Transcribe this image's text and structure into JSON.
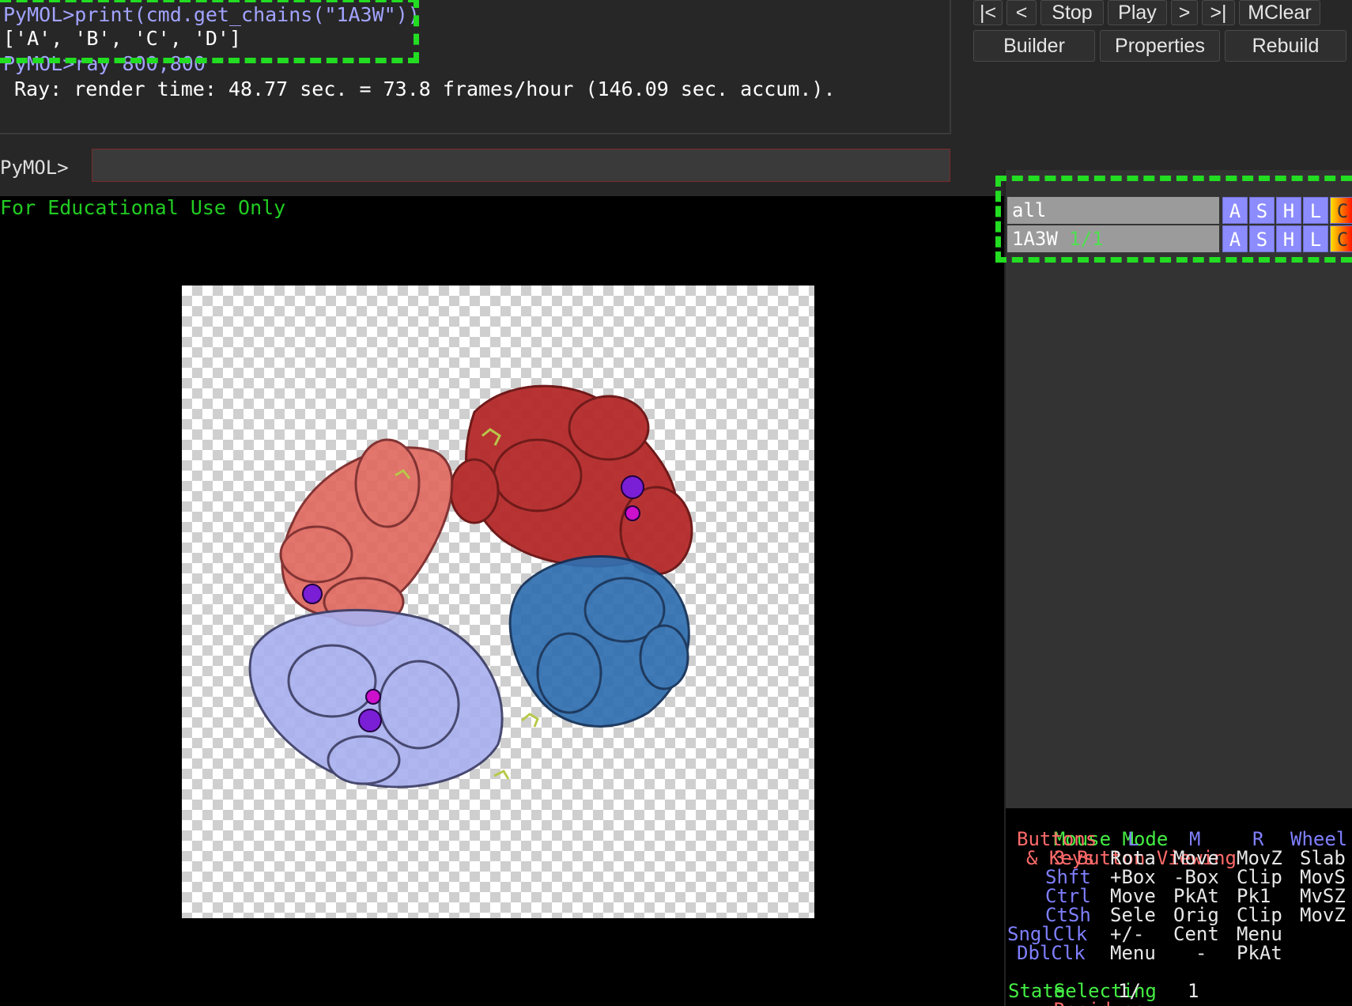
{
  "console": {
    "lines": [
      "PyMOL>print(cmd.get_chains(\"1A3W\"))",
      "['A', 'B', 'C', 'D']",
      "PyMOL>ray 800,800",
      "Ray: render time: 48.77 sec. = 73.8 frames/hour (146.09 sec. accum.)."
    ]
  },
  "command": {
    "prompt": "PyMOL>",
    "value": ""
  },
  "buttons": {
    "first": "|<",
    "prev": "<",
    "stop": "Stop",
    "play": "Play",
    "next": ">",
    "last": ">|",
    "mclear": "MClear",
    "builder": "Builder",
    "properties": "Properties",
    "rebuild": "Rebuild"
  },
  "viewer": {
    "watermark": "For Educational Use Only"
  },
  "objects": [
    {
      "name": "all",
      "state": "",
      "buttons": [
        "A",
        "S",
        "H",
        "L",
        "C"
      ]
    },
    {
      "name": "1A3W",
      "state": "1/1",
      "buttons": [
        "A",
        "S",
        "H",
        "L",
        "C"
      ]
    }
  ],
  "mousehelp": {
    "mode_label": "Mouse Mode",
    "mode_value": "3-Button Viewing",
    "buttons_label": "Buttons",
    "col_l": "L",
    "col_m": "M",
    "col_r": "R",
    "col_wheel": "Wheel",
    "keys_label": "& Keys",
    "rows": [
      {
        "key": "",
        "l": "Rota",
        "m": "Move",
        "r": "MovZ",
        "w": "Slab"
      },
      {
        "key": "Shft",
        "l": "+Box",
        "m": "-Box",
        "r": "Clip",
        "w": "MovS"
      },
      {
        "key": "Ctrl",
        "l": "Move",
        "m": "PkAt",
        "r": "Pk1",
        "w": "MvSZ"
      },
      {
        "key": "CtSh",
        "l": "Sele",
        "m": "Orig",
        "r": "Clip",
        "w": "MovZ"
      },
      {
        "key": "SnglClk",
        "l": "+/-",
        "m": "Cent",
        "r": "Menu",
        "w": ""
      },
      {
        "key": "DblClk",
        "l": "Menu",
        "m": "-",
        "r": "PkAt",
        "w": ""
      }
    ],
    "selecting_label": "Selecting",
    "selecting_value": "Residues",
    "state_label": "State",
    "state_value": "1/",
    "state_count": "1"
  },
  "colors": {
    "accent_green": "#22dd22",
    "prompt_blue": "#a2a3ff",
    "chain_red": "#b52a2a",
    "chain_blue": "#2f6fb0",
    "chain_lavender": "#aab0ee"
  }
}
